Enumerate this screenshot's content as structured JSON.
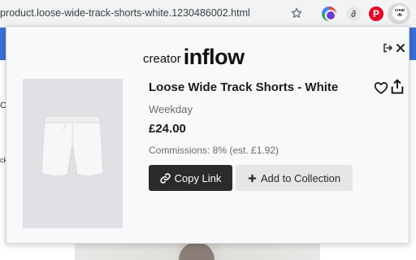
{
  "browser": {
    "url": "product.loose-wide-track-shorts-white.1230486002.html",
    "extensions": [
      {
        "name": "colorwheel-extension",
        "glyph": ""
      },
      {
        "name": "leaf-extension",
        "glyph": "∂"
      },
      {
        "name": "pinterest-extension",
        "glyph": "P"
      },
      {
        "name": "creator-inflow-extension",
        "line1": "creat",
        "line2": "ıfk"
      }
    ]
  },
  "page_behind": {
    "fragment_1": "C",
    "fragment_2": "ck"
  },
  "popup": {
    "logo": {
      "prefix": "creator",
      "name": "inflow"
    },
    "product": {
      "title": "Loose Wide Track Shorts - White",
      "brand": "Weekday",
      "price": "£24.00",
      "commission": "Commissions: 8% (est. £1.92)"
    },
    "buttons": {
      "copy_link": "Copy Link",
      "add_to_collection": "Add to Collection"
    },
    "icons": [
      "signout-icon",
      "close-icon",
      "heart-icon",
      "share-icon",
      "link-icon",
      "plus-icon"
    ]
  },
  "colors": {
    "primary_button": "#2b2b2b",
    "secondary_button": "#e6e6e6",
    "popup_bg": "#f8f9fa",
    "page_accent": "#3b6fd8"
  }
}
